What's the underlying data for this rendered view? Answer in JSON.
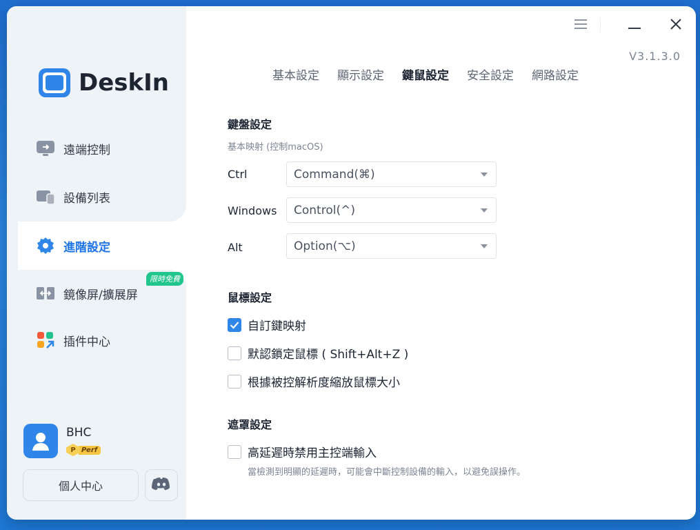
{
  "app": {
    "version": "V3.1.3.0",
    "name": "DeskIn"
  },
  "sidebar": {
    "items": [
      {
        "label": "遠端控制",
        "icon": "remote-control-icon"
      },
      {
        "label": "設備列表",
        "icon": "device-list-icon"
      },
      {
        "label": "進階設定",
        "icon": "gear-icon",
        "active": true
      },
      {
        "label": "鏡像屏/擴展屏",
        "icon": "mirror-screen-icon",
        "badge": "限時免費"
      },
      {
        "label": "插件中心",
        "icon": "plugin-icon"
      }
    ],
    "user": {
      "name": "BHC",
      "badge_letter": "P",
      "badge_label": "Perf"
    },
    "personal_center_label": "個人中心"
  },
  "tabs": [
    {
      "label": "基本設定"
    },
    {
      "label": "顯示設定"
    },
    {
      "label": "鍵鼠設定",
      "active": true
    },
    {
      "label": "安全設定"
    },
    {
      "label": "網路設定"
    }
  ],
  "keyboard": {
    "title": "鍵盤設定",
    "note": "基本映射 (控制macOS)",
    "mappings": [
      {
        "key": "Ctrl",
        "value": "Command(⌘)"
      },
      {
        "key": "Windows",
        "value": "Control(^)"
      },
      {
        "key": "Alt",
        "value": "Option(⌥)"
      }
    ]
  },
  "mouse": {
    "title": "鼠標設定",
    "options": [
      {
        "label": "自訂鍵映射",
        "checked": true
      },
      {
        "label": "默認鎖定鼠標 ( Shift+Alt+Z )",
        "checked": false
      },
      {
        "label": "根據被控解析度縮放鼠標大小",
        "checked": false
      }
    ]
  },
  "mask": {
    "title": "遮罩設定",
    "option": {
      "label": "高延遲時禁用主控端輸入",
      "checked": false
    },
    "hint": "當檢測到明顯的延遲時，可能會中斷控制設備的輸入，以避免誤操作。"
  },
  "colors": {
    "accent": "#2f86e8",
    "active_text": "#1f75e8",
    "badge_green": "#21c58e"
  }
}
